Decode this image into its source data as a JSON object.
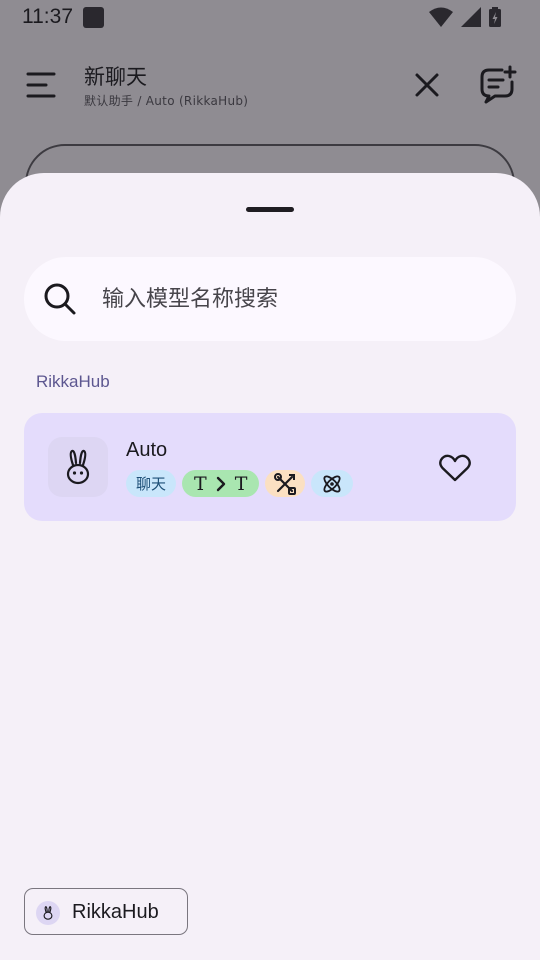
{
  "status_bar": {
    "time": "11:37"
  },
  "app_bar": {
    "title": "新聊天",
    "subtitle": "默认助手 / Auto (RikkaHub)"
  },
  "sheet": {
    "search": {
      "placeholder": "输入模型名称搜索",
      "value": ""
    },
    "group_header": "RikkaHub",
    "models": [
      {
        "name": "Auto",
        "tags": {
          "chat": "聊天",
          "io_input": "T",
          "io_output": "T"
        },
        "icons": [
          "rabbit-icon",
          "tool-icon",
          "reasoning-icon",
          "heart-outline-icon"
        ],
        "favorite": false,
        "selected": true
      }
    ],
    "provider_chip": {
      "label": "RikkaHub"
    }
  },
  "colors": {
    "scrim": "#8f8c92",
    "sheet_bg": "#f5f0f8",
    "selected_card": "#e4dcfc",
    "group_header": "#5d5790",
    "tag_chat": "#c9e6fb",
    "tag_io": "#a9e6b0",
    "tag_tool": "#fbe0c2"
  }
}
